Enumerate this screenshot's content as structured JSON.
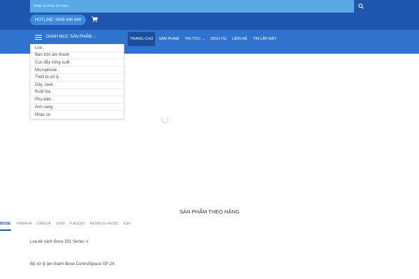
{
  "search": {
    "placeholder": "Nhập từ khóa tìm kiếm"
  },
  "header": {
    "hotline": "HOTLINE: 0949 440 440"
  },
  "nav": {
    "categories_label": "DANH MỤC SẢN PHẨM",
    "menu": [
      "TRANG CHỦ",
      "SẢN PHẨM",
      "TIN TỨC",
      "DỊCH VỤ",
      "LIÊN HỆ",
      "TIN LẮP ĐẶT"
    ]
  },
  "dropdown": {
    "items": [
      "Loa",
      "Bàn trộn âm thanh",
      "Cục đẩy công suất",
      "Microphone",
      "Thiết bị xử lý",
      "Dây, Jack",
      "Ruột loa",
      "Phụ kiện",
      "Ánh sáng",
      "Nhạc cụ"
    ]
  },
  "brands": {
    "title": "SẢN PHẨM THEO HÃNG",
    "tabs": [
      "BOSE",
      "YAMAHA",
      "OMEGA",
      "OHM",
      "P.AUDIO",
      "RENKUS-HEINZ",
      "K&F"
    ]
  },
  "products": [
    "Loa kệ sách Bose 301 Series V",
    "Bộ xử lý âm thanh Bose ControlSpace SP-24"
  ],
  "colors": {
    "primary": "#1f56ad",
    "nav": "#2f73cf",
    "search": "#58a9e6"
  }
}
